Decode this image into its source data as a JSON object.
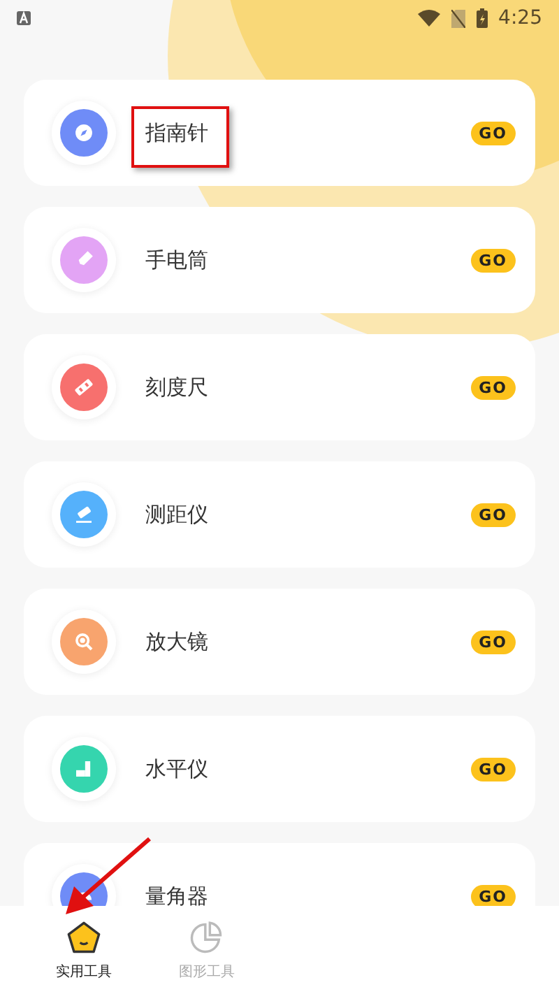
{
  "status_bar": {
    "time": "4:25"
  },
  "tools": [
    {
      "name": "指南针",
      "kind": "compass",
      "color": "#6f8cf7",
      "action": "GO"
    },
    {
      "name": "手电筒",
      "kind": "flashlight",
      "color": "#e3a4f5",
      "action": "GO"
    },
    {
      "name": "刻度尺",
      "kind": "ruler",
      "color": "#f7706e",
      "action": "GO"
    },
    {
      "name": "测距仪",
      "kind": "rangefinder",
      "color": "#55b1fb",
      "action": "GO"
    },
    {
      "name": "放大镜",
      "kind": "magnifier",
      "color": "#f8a46e",
      "action": "GO"
    },
    {
      "name": "水平仪",
      "kind": "level",
      "color": "#35d5ae",
      "action": "GO"
    },
    {
      "name": "量角器",
      "kind": "protractor",
      "color": "#6f8cf7",
      "action": "GO"
    }
  ],
  "tabs": [
    {
      "label": "实用工具",
      "kind": "tools",
      "selected": true
    },
    {
      "label": "图形工具",
      "kind": "shapes",
      "selected": false
    }
  ],
  "annotations": [
    {
      "kind": "box"
    },
    {
      "kind": "arrow"
    }
  ]
}
